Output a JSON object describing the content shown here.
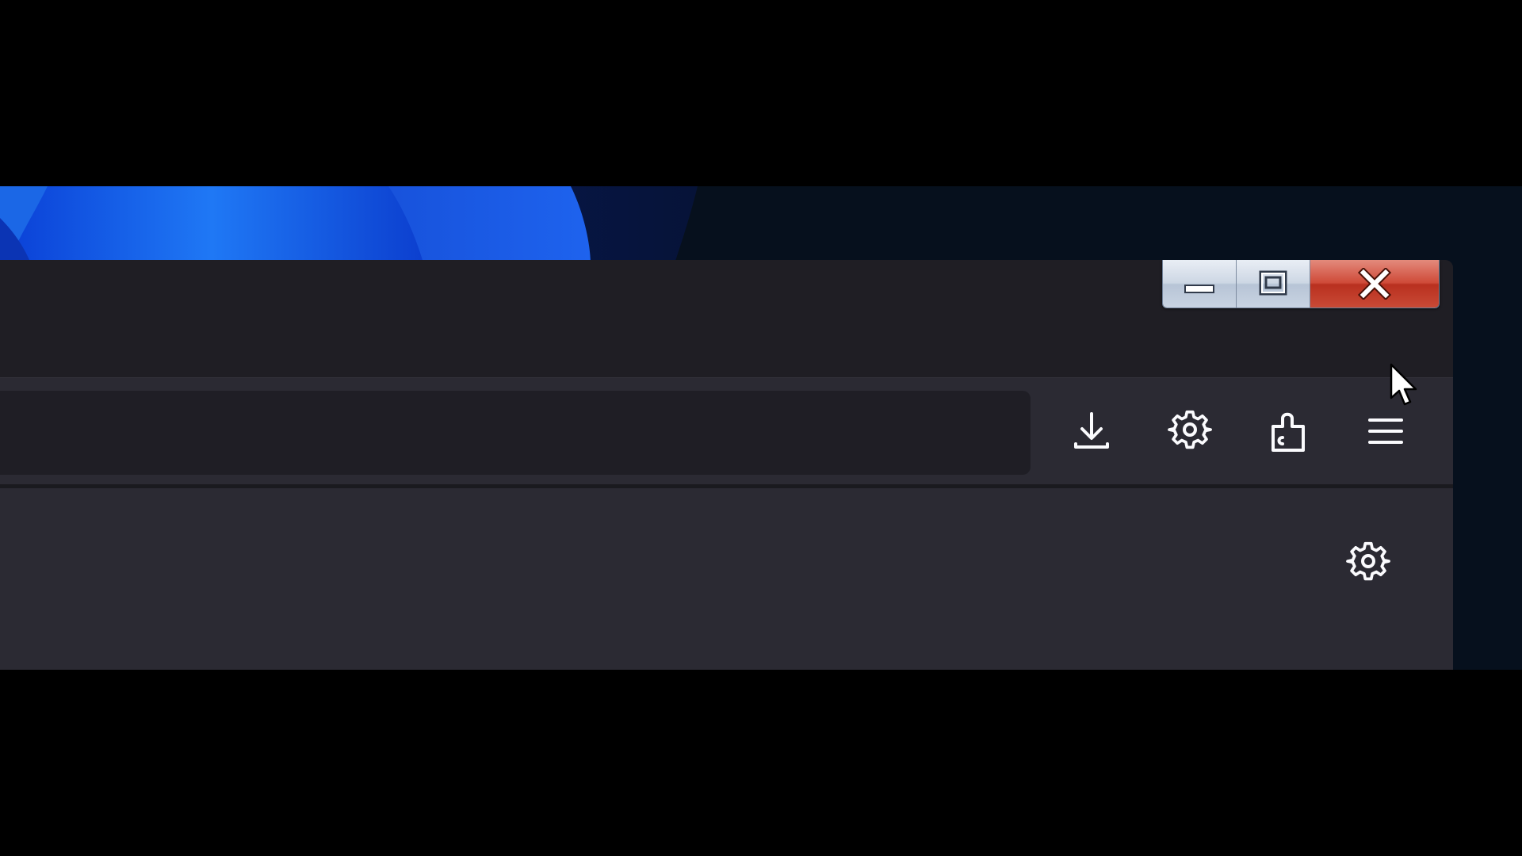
{
  "window": {
    "caption_buttons": [
      {
        "name": "minimize",
        "icon": "minimize-icon"
      },
      {
        "name": "maximize",
        "icon": "restore-icon"
      },
      {
        "name": "close",
        "icon": "close-icon"
      }
    ],
    "close_color": "#c9402e"
  },
  "toolbar": {
    "url_value": "",
    "icons": [
      "download-icon",
      "gear-icon",
      "puzzle-extensions-icon",
      "hamburger-menu-icon"
    ]
  },
  "content": {
    "icons": [
      "gear-icon"
    ]
  },
  "theme": {
    "frame": "#1f1e24",
    "toolbar": "#2b2a33",
    "urlbar": "#1f1e25",
    "icon": "#fbfbfe"
  }
}
